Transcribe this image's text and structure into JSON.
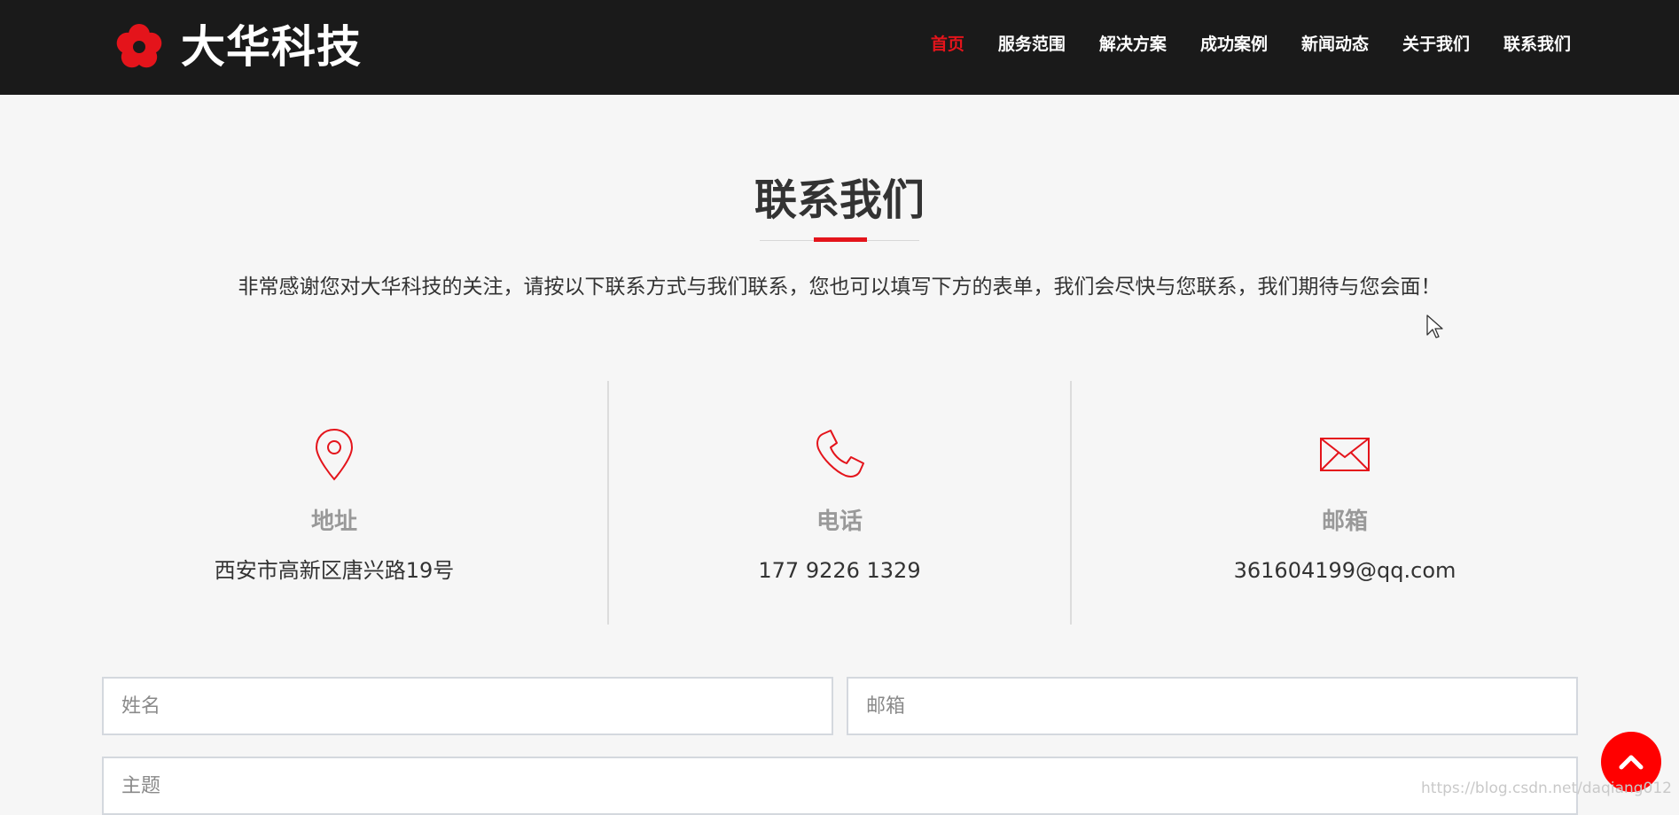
{
  "header": {
    "logo_text": "大华科技",
    "nav": [
      {
        "label": "首页",
        "active": true
      },
      {
        "label": "服务范围",
        "active": false
      },
      {
        "label": "解决方案",
        "active": false
      },
      {
        "label": "成功案例",
        "active": false
      },
      {
        "label": "新闻动态",
        "active": false
      },
      {
        "label": "关于我们",
        "active": false
      },
      {
        "label": "联系我们",
        "active": false
      }
    ]
  },
  "contact": {
    "title": "联系我们",
    "intro": "非常感谢您对大华科技的关注，请按以下联系方式与我们联系，您也可以填写下方的表单，我们会尽快与您联系，我们期待与您会面！",
    "address": {
      "icon": "location-pin-icon",
      "label": "地址",
      "value": "西安市高新区唐兴路19号"
    },
    "phone": {
      "icon": "phone-icon",
      "label": "电话",
      "value": "177 9226 1329"
    },
    "email": {
      "icon": "mail-icon",
      "label": "邮箱",
      "value": "361604199@qq.com"
    }
  },
  "form": {
    "name_placeholder": "姓名",
    "email_placeholder": "邮箱",
    "subject_placeholder": "主题"
  },
  "watermark": "https://blog.csdn.net/daqiang012",
  "colors": {
    "accent": "#e4141b",
    "header_bg": "#1a1a1a",
    "page_bg": "#f6f6f6"
  }
}
